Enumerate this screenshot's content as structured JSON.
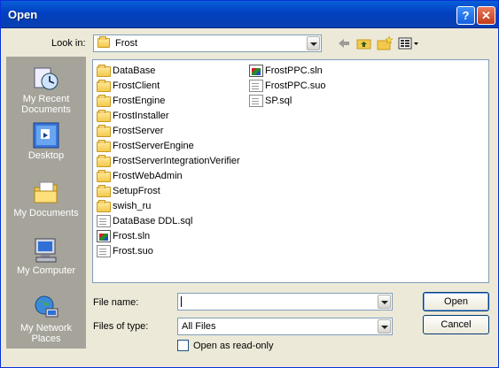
{
  "window": {
    "title": "Open",
    "help_glyph": "?",
    "close_glyph": "✕"
  },
  "lookin": {
    "label": "Look in:",
    "value": "Frost"
  },
  "toolbar": {
    "icons": [
      "back-arrow-icon",
      "up-folder-icon",
      "new-folder-icon",
      "view-menu-icon"
    ]
  },
  "places": [
    {
      "label": "My Recent Documents",
      "icon": "recent-documents-icon"
    },
    {
      "label": "Desktop",
      "icon": "desktop-icon"
    },
    {
      "label": "My Documents",
      "icon": "my-documents-icon"
    },
    {
      "label": "My Computer",
      "icon": "my-computer-icon"
    },
    {
      "label": "My Network Places",
      "icon": "network-places-icon"
    }
  ],
  "files": {
    "col1": [
      {
        "name": "DataBase",
        "kind": "folder"
      },
      {
        "name": "FrostClient",
        "kind": "folder"
      },
      {
        "name": "FrostEngine",
        "kind": "folder"
      },
      {
        "name": "FrostInstaller",
        "kind": "folder"
      },
      {
        "name": "FrostServer",
        "kind": "folder"
      },
      {
        "name": "FrostServerEngine",
        "kind": "folder"
      },
      {
        "name": "FrostServerIntegrationVerifier",
        "kind": "folder"
      },
      {
        "name": "FrostWebAdmin",
        "kind": "folder"
      },
      {
        "name": "SetupFrost",
        "kind": "folder"
      },
      {
        "name": "swish_ru",
        "kind": "folder"
      },
      {
        "name": "DataBase DDL.sql",
        "kind": "doc"
      },
      {
        "name": "Frost.sln",
        "kind": "sln"
      },
      {
        "name": "Frost.suo",
        "kind": "doc"
      }
    ],
    "col2": [
      {
        "name": "FrostPPC.sln",
        "kind": "sln"
      },
      {
        "name": "FrostPPC.suo",
        "kind": "doc"
      },
      {
        "name": "SP.sql",
        "kind": "doc"
      }
    ]
  },
  "filename": {
    "label": "File name:",
    "value": ""
  },
  "filetype": {
    "label": "Files of type:",
    "value": "All Files"
  },
  "readonly": {
    "label": "Open as read-only",
    "checked": false
  },
  "buttons": {
    "open": "Open",
    "cancel": "Cancel"
  }
}
